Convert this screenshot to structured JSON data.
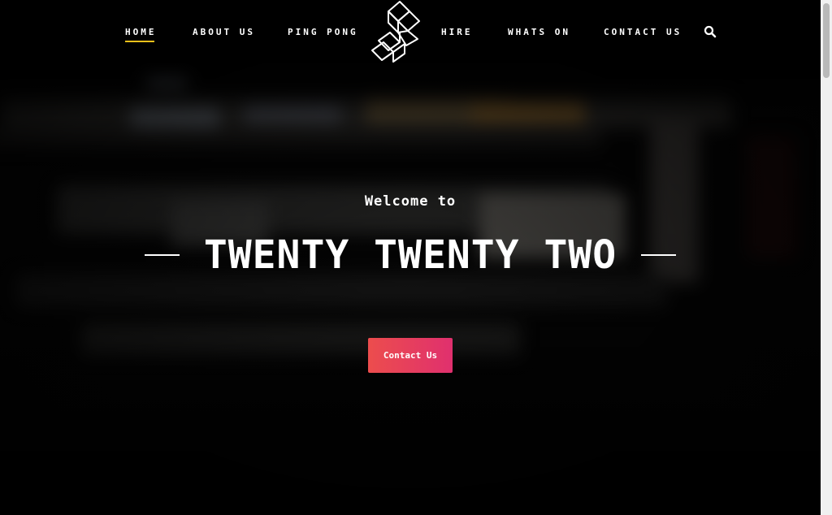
{
  "nav": {
    "left_items": [
      {
        "label": "HOME",
        "active": true
      },
      {
        "label": "ABOUT US",
        "active": false
      },
      {
        "label": "PING PONG",
        "active": false
      }
    ],
    "right_items": [
      {
        "label": "HIRE",
        "active": false
      },
      {
        "label": "WHATS ON",
        "active": false
      },
      {
        "label": "CONTACT US",
        "active": false
      }
    ],
    "search_icon": "search-icon",
    "logo_icon": "stacked-blocks-logo"
  },
  "hero": {
    "welcome": "Welcome to",
    "title": "TWENTY TWENTY TWO",
    "cta_label": "Contact Us"
  },
  "colors": {
    "background": "#000000",
    "active_underline": "#f2c11a",
    "cta_gradient_start": "#ec4d4d",
    "cta_gradient_end": "#e0306e"
  }
}
